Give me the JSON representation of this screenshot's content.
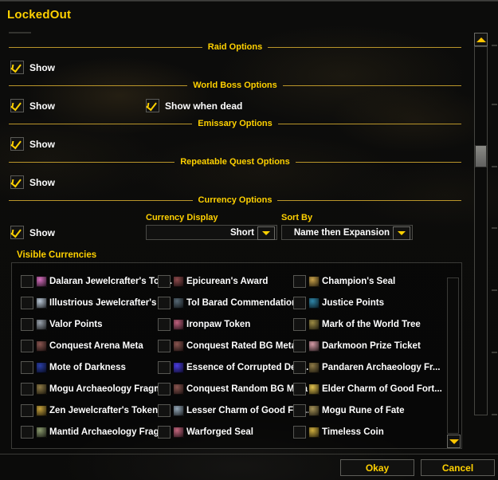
{
  "window": {
    "title": "LockedOut"
  },
  "sections": {
    "raid": {
      "header": "Raid Options",
      "show_label": "Show",
      "show_checked": true
    },
    "world_boss": {
      "header": "World Boss Options",
      "show_label": "Show",
      "show_checked": true,
      "show_when_dead_label": "Show when dead",
      "show_when_dead_checked": true
    },
    "emissary": {
      "header": "Emissary Options",
      "show_label": "Show",
      "show_checked": true
    },
    "repeatable_quest": {
      "header": "Repeatable Quest Options",
      "show_label": "Show",
      "show_checked": true
    },
    "currency": {
      "header": "Currency Options",
      "show_label": "Show",
      "show_checked": true,
      "currency_display": {
        "label": "Currency Display",
        "value": "Short"
      },
      "sort_by": {
        "label": "Sort By",
        "value": "Name then Expansion"
      },
      "visible_currencies_label": "Visible Currencies"
    }
  },
  "currencies": [
    {
      "name": "Dalaran Jewelcrafter's Tok...",
      "checked": false,
      "icon": "#d86fc0"
    },
    {
      "name": "Epicurean's Award",
      "checked": false,
      "icon": "#8d4a4c"
    },
    {
      "name": "Champion's Seal",
      "checked": false,
      "icon": "#c9a24a"
    },
    {
      "name": "Illustrious Jewelcrafter's ...",
      "checked": false,
      "icon": "#b9c7d6"
    },
    {
      "name": "Tol Barad Commendation",
      "checked": false,
      "icon": "#566874"
    },
    {
      "name": "Justice Points",
      "checked": false,
      "icon": "#2f86a8"
    },
    {
      "name": "Valor Points",
      "checked": false,
      "icon": "#9aa3ad"
    },
    {
      "name": "Ironpaw Token",
      "checked": false,
      "icon": "#c0607e"
    },
    {
      "name": "Mark of the World Tree",
      "checked": false,
      "icon": "#9c8b44"
    },
    {
      "name": "Conquest Arena Meta",
      "checked": false,
      "icon": "#8a5550"
    },
    {
      "name": "Conquest Rated BG Meta",
      "checked": false,
      "icon": "#8a5550"
    },
    {
      "name": "Darkmoon Prize Ticket",
      "checked": false,
      "icon": "#d49aa6"
    },
    {
      "name": "Mote of Darkness",
      "checked": false,
      "icon": "#2a3ea8"
    },
    {
      "name": "Essence of Corrupted Dea...",
      "checked": false,
      "icon": "#4a3ce0"
    },
    {
      "name": "Pandaren Archaeology Fr...",
      "checked": false,
      "icon": "#8e7a46"
    },
    {
      "name": "Mogu Archaeology Fragm...",
      "checked": false,
      "icon": "#8e7a46"
    },
    {
      "name": "Conquest Random BG Meta",
      "checked": false,
      "icon": "#8a5550"
    },
    {
      "name": "Elder Charm of Good Fort...",
      "checked": false,
      "icon": "#e2c24e"
    },
    {
      "name": "Zen Jewelcrafter's Token",
      "checked": false,
      "icon": "#c6a23c"
    },
    {
      "name": "Lesser Charm of Good For...",
      "checked": false,
      "icon": "#93a6b6"
    },
    {
      "name": "Mogu Rune of Fate",
      "checked": false,
      "icon": "#a59258"
    },
    {
      "name": "Mantid Archaeology Frag...",
      "checked": false,
      "icon": "#8a9a6e"
    },
    {
      "name": "Warforged Seal",
      "checked": false,
      "icon": "#c4667e"
    },
    {
      "name": "Timeless Coin",
      "checked": false,
      "icon": "#cfae3e"
    }
  ],
  "scrollbars": {
    "main_up_icon": "scroll-up-arrow",
    "main_down_icon": "scroll-down-arrow",
    "currency_down_icon": "scroll-down-arrow"
  },
  "footer": {
    "okay_label": "Okay",
    "cancel_label": "Cancel"
  }
}
